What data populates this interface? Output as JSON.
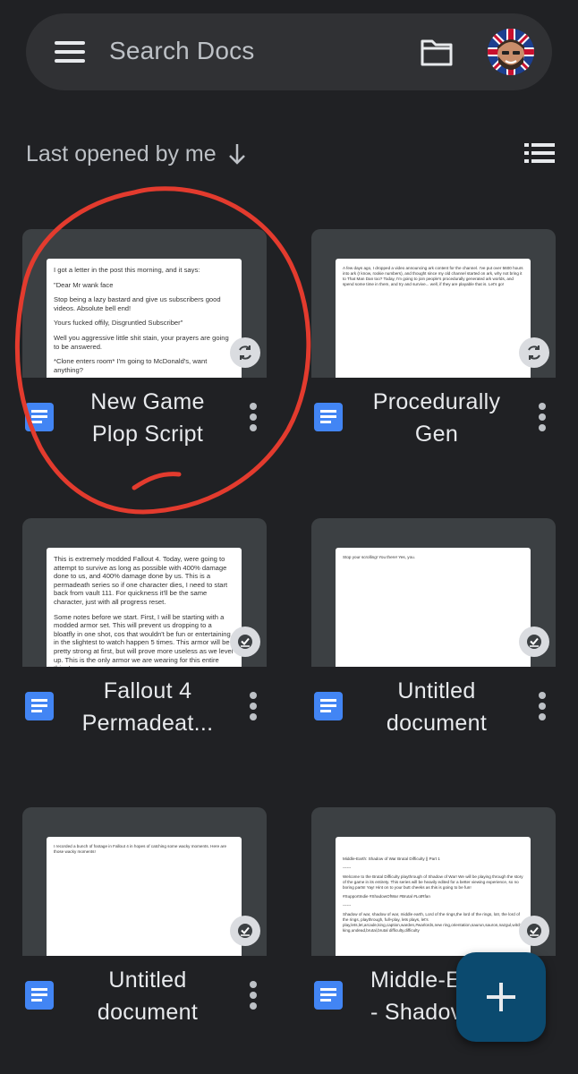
{
  "search": {
    "placeholder": "Search Docs"
  },
  "sort": {
    "label": "Last opened by me"
  },
  "colors": {
    "background": "#202124",
    "doc_blue": "#4285f4",
    "fab": "#0b4a6f",
    "annotation_red": "#e33b2e"
  },
  "documents": [
    {
      "title_line1": "New Game",
      "title_line2": "Plop Script",
      "status_icon": "sync-icon",
      "preview": [
        "I got a letter in the post this morning, and it says:",
        "\"Dear Mr wank face",
        "Stop being a lazy bastard and give us subscribers good videos. Absolute bell end!",
        "Yours fucked offily, Disgruntled Subscriber\"",
        "Well you aggressive little shit stain, your prayers are going to be answered.",
        "*Clone enters room* I'm going to McDonald's, want anything?"
      ]
    },
    {
      "title_line1": "Procedurally",
      "title_line2": "Gen",
      "status_icon": "sync-icon",
      "preview": [
        "A few days ago, I dropped a video announcing ark content for the channel. I've put over 5600 hours into ark (I know, rookie numbers), and thought since my old channel started on ark, why not bring it to That Man Dan too? Today, I'm going to join people's procedurally generated ark worlds, and spend some time in them, and try and survive... well, if they are playable that is. Let's go!"
      ]
    },
    {
      "title_line1": "Fallout 4",
      "title_line2": "Permadeat...",
      "status_icon": "offline-check-icon",
      "preview": [
        "This is extremely modded Fallout 4. Today, were going to attempt to survive as long as possible with 400% damage done to us, and 400% damage done by us. This is a permadeath series so if one character dies, I need to start back from vault 111. For quickness it'll be the same character, just with all progress reset.",
        "Some notes before we start. First, I will be starting with a modded armor set. This will prevent us dropping to a bloatfly in one shot, cos that wouldn't be fun or entertaining in the slightest to watch happen 5 times. This armor will be pretty strong at first, but will prove more useless as we level up. This is the only armor we are wearing for this entire thing!"
      ]
    },
    {
      "title_line1": "Untitled",
      "title_line2": "document",
      "status_icon": "offline-check-icon",
      "preview": [
        "Stop your scrolling! You there! Yes, you."
      ]
    },
    {
      "title_line1": "Untitled",
      "title_line2": "document",
      "status_icon": "offline-check-icon",
      "preview": [
        "I recorded a bunch of footage in Fallout 4 in hopes of catching some wacky moments. Here are those wacky moments!"
      ]
    },
    {
      "title_line1": "Middle-E",
      "title_line2": "- Shadov",
      "status_icon": "offline-check-icon",
      "preview": [
        "Middle-Earth: Shadow of War Brutal Difficulty || Part 1",
        "------",
        "Welcome to the Brutal Difficulty playthrough of Shadow of War! We will be playing through the story of the game in its entirety. This series will be heavily edited for a better viewing experience, so no boring parts! Yay! Hint on to your butt cheeks as this is going to be fun!",
        "#SupportIndie #ShadowOfWar #Brutal #LotRfan",
        "------",
        "Shadow of war, shadow of war, middle earth, Lord of the rings,the lord of the rings, lotr, the lord of the rings, playthrough, full+play, lets plays, let's play,lets,let,arcade,king,caption,warden,#warlords,new ring,orientation,saurun,sauron,nazgul,witch king,undead,brutal,brutal difficulty,difficulty"
      ]
    }
  ]
}
